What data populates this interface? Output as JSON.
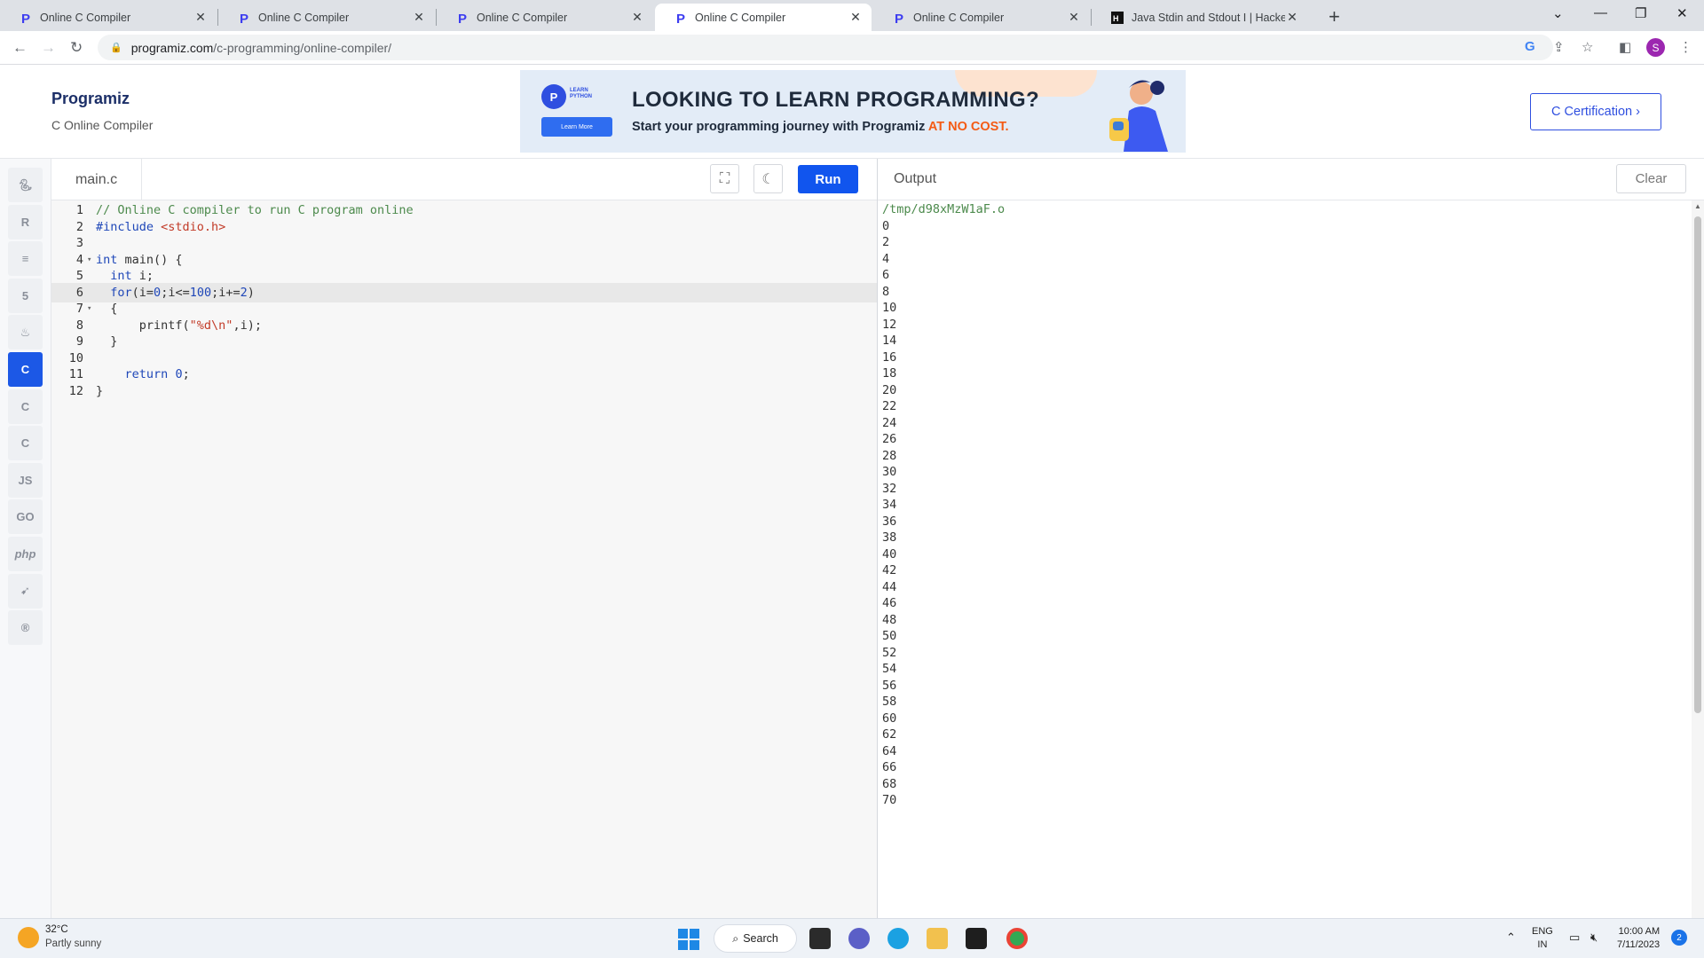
{
  "browser": {
    "tabs": [
      {
        "title": "Online C Compiler",
        "active": false
      },
      {
        "title": "Online C Compiler",
        "active": false
      },
      {
        "title": "Online C Compiler",
        "active": false
      },
      {
        "title": "Online C Compiler",
        "active": true
      },
      {
        "title": "Online C Compiler",
        "active": false
      },
      {
        "title": "Java Stdin and Stdout I | HackerR",
        "active": false
      }
    ],
    "url_host": "programiz.com",
    "url_path": "/c-programming/online-compiler/",
    "profile_initial": "S"
  },
  "header": {
    "logo": "Programiz",
    "subtitle": "C Online Compiler",
    "banner": {
      "badge_text_line1": "LEARN",
      "badge_text_line2": "PYTHON",
      "learn_more": "Learn More",
      "headline": "LOOKING TO LEARN PROGRAMMING?",
      "tagline": "Start your programming journey with Programiz ",
      "tagline_accent": "AT NO COST."
    },
    "cert_button": "C Certification ›"
  },
  "rail": {
    "items": [
      "python",
      "r",
      "sql",
      "html",
      "java",
      "c",
      "cpp",
      "csharp",
      "js",
      "go",
      "php",
      "swift",
      "rust"
    ],
    "labels": {
      "js": "JS",
      "go": "GO",
      "php": "php"
    },
    "active": "c"
  },
  "editor": {
    "filename": "main.c",
    "run_label": "Run",
    "lines": [
      {
        "n": "1",
        "fold": "",
        "text": "// Online C compiler to run C program online"
      },
      {
        "n": "2",
        "fold": "",
        "text": "#include <stdio.h>"
      },
      {
        "n": "3",
        "fold": "",
        "text": ""
      },
      {
        "n": "4",
        "fold": "▾",
        "text": "int main() {"
      },
      {
        "n": "5",
        "fold": "",
        "text": "  int i;"
      },
      {
        "n": "6",
        "fold": "",
        "text": "  for(i=0;i<=100;i+=2)"
      },
      {
        "n": "7",
        "fold": "▾",
        "text": "  {"
      },
      {
        "n": "8",
        "fold": "",
        "text": "      printf(\"%d\\n\",i);"
      },
      {
        "n": "9",
        "fold": "",
        "text": "  }"
      },
      {
        "n": "10",
        "fold": "",
        "text": ""
      },
      {
        "n": "11",
        "fold": "",
        "text": "    return 0;"
      },
      {
        "n": "12",
        "fold": "",
        "text": "}"
      }
    ],
    "highlighted_line": 6
  },
  "output": {
    "title": "Output",
    "clear_label": "Clear",
    "path": "/tmp/d98xMzW1aF.o",
    "lines": [
      "0",
      "2",
      "4",
      "6",
      "8",
      "10",
      "12",
      "14",
      "16",
      "18",
      "20",
      "22",
      "24",
      "26",
      "28",
      "30",
      "32",
      "34",
      "36",
      "38",
      "40",
      "42",
      "44",
      "46",
      "48",
      "50",
      "52",
      "54",
      "56",
      "58",
      "60",
      "62",
      "64",
      "66",
      "68",
      "70"
    ]
  },
  "taskbar": {
    "temp": "32°C",
    "weather": "Partly sunny",
    "search": "Search",
    "lang_line1": "ENG",
    "lang_line2": "IN",
    "time": "10:00 AM",
    "date": "7/11/2023",
    "notifications": "2"
  },
  "colors": {
    "accent": "#1155ee",
    "brand": "#2f4fe0",
    "comment": "#4c8a4c",
    "keyword": "#1f47b8",
    "string": "#c23b28"
  }
}
